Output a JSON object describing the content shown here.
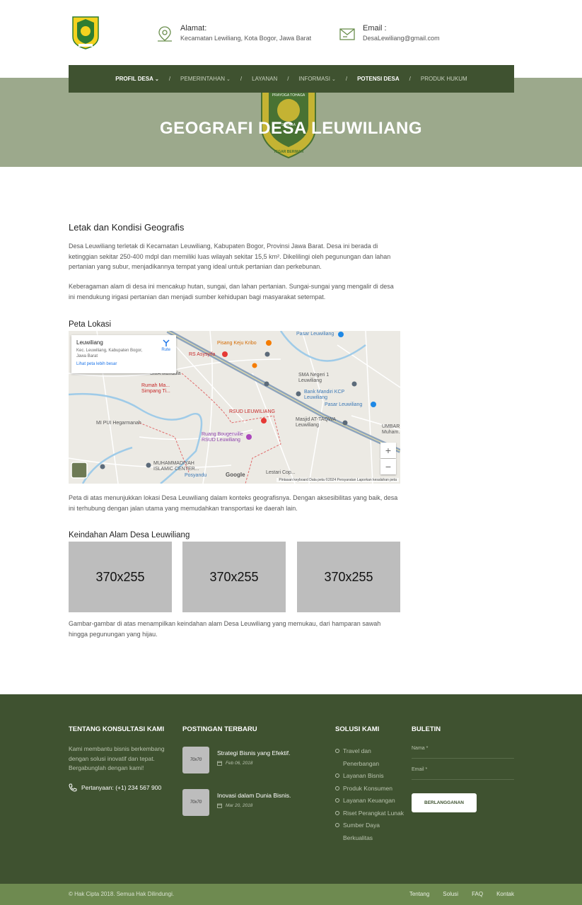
{
  "header": {
    "address_title": "Alamat:",
    "address_value": "Kecamatan Lewiliang, Kota Bogor, Jawa Barat",
    "email_title": "Email :",
    "email_value": "DesaLewiliang@gmail.com"
  },
  "nav": {
    "items": [
      {
        "label": "PROFIL DESA",
        "dropdown": true,
        "active": true
      },
      {
        "label": "PEMERINTAHAN",
        "dropdown": true,
        "active": false
      },
      {
        "label": "LAYANAN",
        "dropdown": false,
        "active": false
      },
      {
        "label": "INFORMASI",
        "dropdown": true,
        "active": false
      },
      {
        "label": "POTENSI DESA",
        "dropdown": false,
        "active": true
      },
      {
        "label": "PRODUK HUKUM",
        "dropdown": false,
        "active": false
      }
    ],
    "separator": "/"
  },
  "hero": {
    "title": "GEOGRAFI DESA LEUWILIANG",
    "emblem_text_top": "PRAYOGA TOHAGA",
    "emblem_text_mid": "SAYAGA",
    "emblem_text_bottom": "TEGAR BERIMAN"
  },
  "main": {
    "section1_title": "Letak dan Kondisi Geografis",
    "para1": "Desa Leuwiliang terletak di Kecamatan Leuwiliang, Kabupaten Bogor, Provinsi Jawa Barat. Desa ini berada di ketinggian sekitar 250-400 mdpl dan memiliki luas wilayah sekitar 15,5 km². Dikelilingi oleh pegunungan dan lahan pertanian yang subur, menjadikannya tempat yang ideal untuk pertanian dan perkebunan.",
    "para2": "Keberagaman alam di desa ini mencakup hutan, sungai, dan lahan pertanian. Sungai-sungai yang mengalir di desa ini mendukung irigasi pertanian dan menjadi sumber kehidupan bagi masyarakat setempat.",
    "map_title": "Peta Lokasi",
    "map_caption": "Peta di atas menunjukkan lokasi Desa Leuwiliang dalam konteks geografisnya. Dengan aksesibilitas yang baik, desa ini terhubung dengan jalan utama yang memudahkan transportasi ke daerah lain.",
    "gallery_title": "Keindahan Alam Desa Leuwiliang",
    "gallery": [
      "370x255",
      "370x255",
      "370x255"
    ],
    "gallery_caption": "Gambar-gambar di atas menampilkan keindahan alam Desa Leuwiliang yang memukau, dari hamparan sawah hingga pegunungan yang hijau."
  },
  "map": {
    "card_name": "Leuwiliang",
    "card_address": "Kec. Leuwiliang, Kabupaten Bogor, Jawa Barat",
    "card_link": "Lihat peta lebih besar",
    "card_route": "Rute",
    "zoom_in": "+",
    "zoom_out": "−",
    "google": "Google",
    "attribution": "Pintasan keyboard   Data peta ©2024   Persyaratan   Laporkan kesalahan peta",
    "labels": {
      "pasar_leuwiliang": "Pasar Leuwiliang",
      "pisang_keju": "Pisang Keju Kribo",
      "rs_asysyifa": "RS Asysyifa",
      "sma_mandala": "SMA Mandala",
      "rumah_makan": "Rumah Ma... Simpang Ti...",
      "sma_negeri": "SMA Negeri 1 Leuwiliang",
      "bank_mandiri": "Bank Mandiri KCP Leuwiliang",
      "pasar_leuwiliang2": "Pasar Leuwiliang",
      "rsud": "RSUD LEUWILIANG",
      "masjid": "Masjid AT-TAQWA Leuwiliang",
      "umbar": "UMBAR Muham...",
      "mi_pui": "MI PUI Hegarmanah",
      "ruang": "Ruang Bougenville RSUD Leuwiliang",
      "muhammadiyah": "MUHAMMADIYAH ISLAMIC CENTER...",
      "posyandu": "Posyandu",
      "lestari": "Lestari Cop..."
    }
  },
  "footer": {
    "about_title": "TENTANG KONSULTASI KAMI",
    "about_text": "Kami membantu bisnis berkembang dengan solusi inovatif dan tepat. Bergabunglah dengan kami!",
    "phone": "Pertanyaan: (+1) 234 567 900",
    "posts_title": "POSTINGAN TERBARU",
    "posts": [
      {
        "thumb": "70x70",
        "title": "Strategi Bisnis yang Efektif.",
        "date": "Feb 06, 2018"
      },
      {
        "thumb": "70x70",
        "title": "Inovasi dalam Dunia Bisnis.",
        "date": "Mar 20, 2018"
      }
    ],
    "solutions_title": "SOLUSI KAMI",
    "solutions": [
      "Travel dan Penerbangan",
      "Layanan Bisnis",
      "Produk Konsumen",
      "Layanan Keuangan",
      "Riset Perangkat Lunak",
      "Sumber Daya Berkualitas"
    ],
    "newsletter_title": "BULETIN",
    "name_placeholder": "Nama *",
    "email_placeholder": "Email *",
    "subscribe_label": "BERLANGGANAN",
    "copyright": "© Hak Cipta 2018. Semua Hak Dilindungi.",
    "links": [
      "Tentang",
      "Solusi",
      "FAQ",
      "Kontak"
    ]
  },
  "colors": {
    "primary_green": "#3f5230",
    "hero_bg": "#9ca98c",
    "bottom_bar": "#6e8a50",
    "placeholder_grey": "#bdbdbd"
  }
}
